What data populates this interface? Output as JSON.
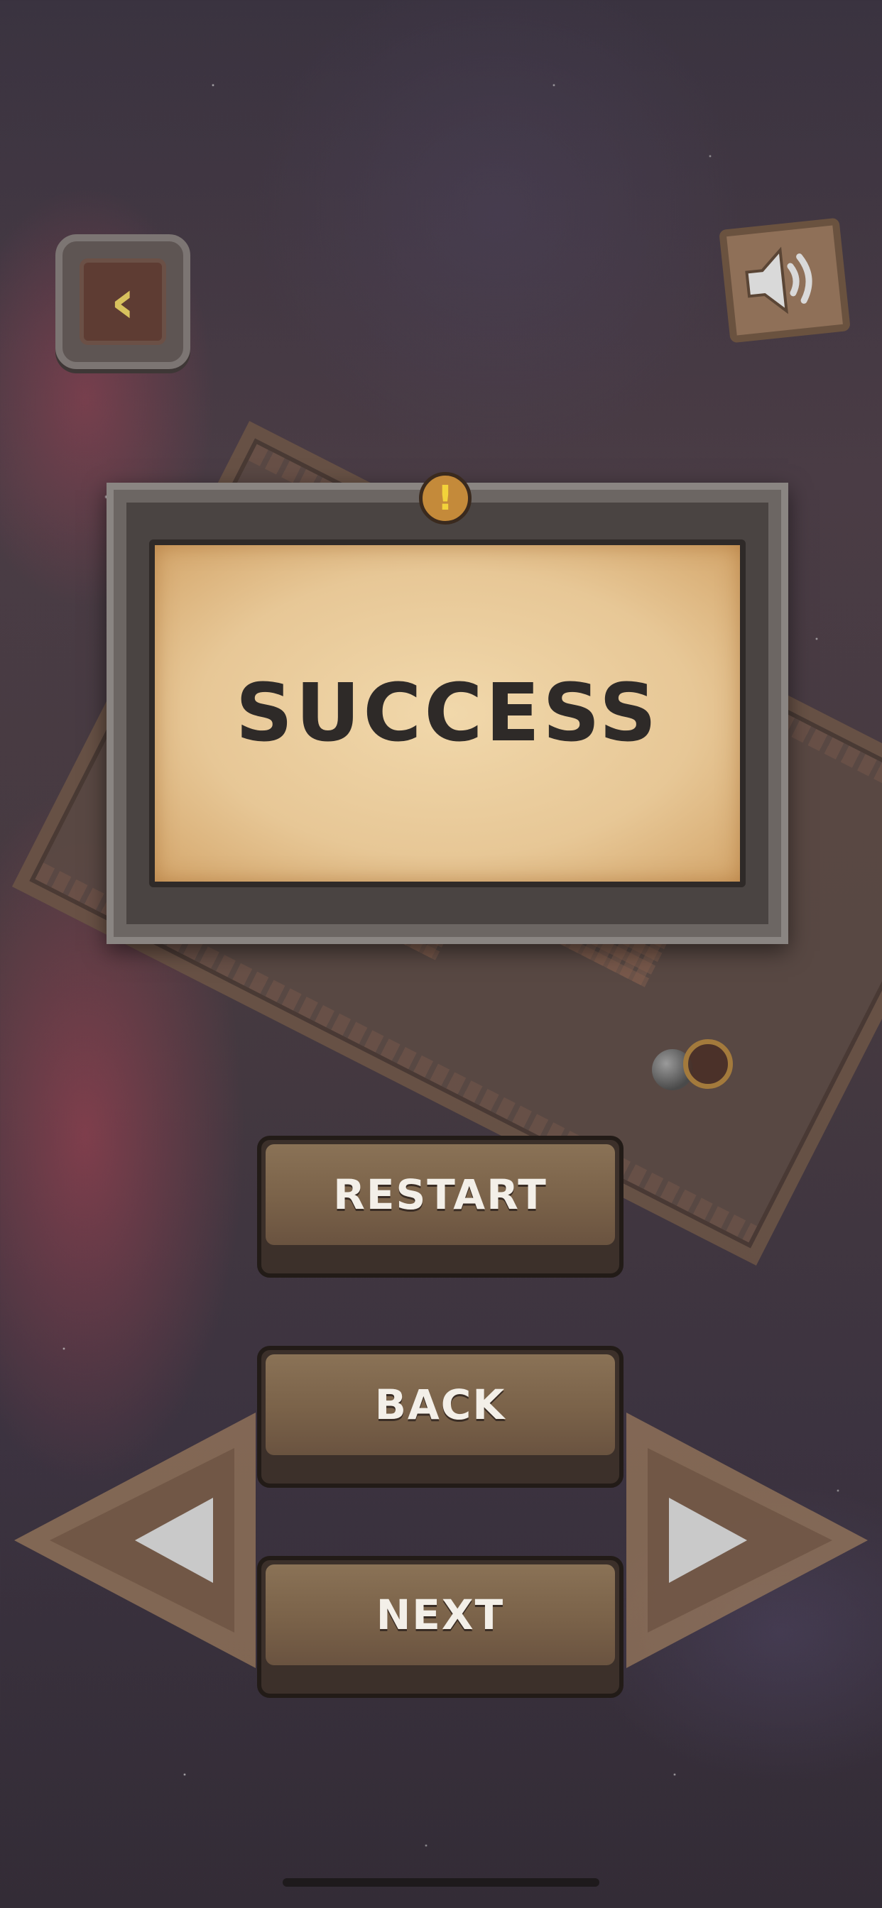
{
  "dialog": {
    "title": "SUCCESS",
    "badge_icon": "exclamation-icon",
    "badge_glyph": "!"
  },
  "top_bar": {
    "back_icon": "chevron-left-icon",
    "back_glyph": "‹",
    "sound_icon": "speaker-volume-icon"
  },
  "buttons": {
    "restart_label": "RESTART",
    "back_label": "BACK",
    "next_label": "NEXT"
  },
  "navigation": {
    "prev_icon": "triangle-left-icon",
    "next_icon": "triangle-right-icon"
  },
  "colors": {
    "parchment": "#e7c796",
    "wood_button": "#7a6249",
    "title_text": "#2e2a28",
    "badge": "#c48a3a"
  }
}
